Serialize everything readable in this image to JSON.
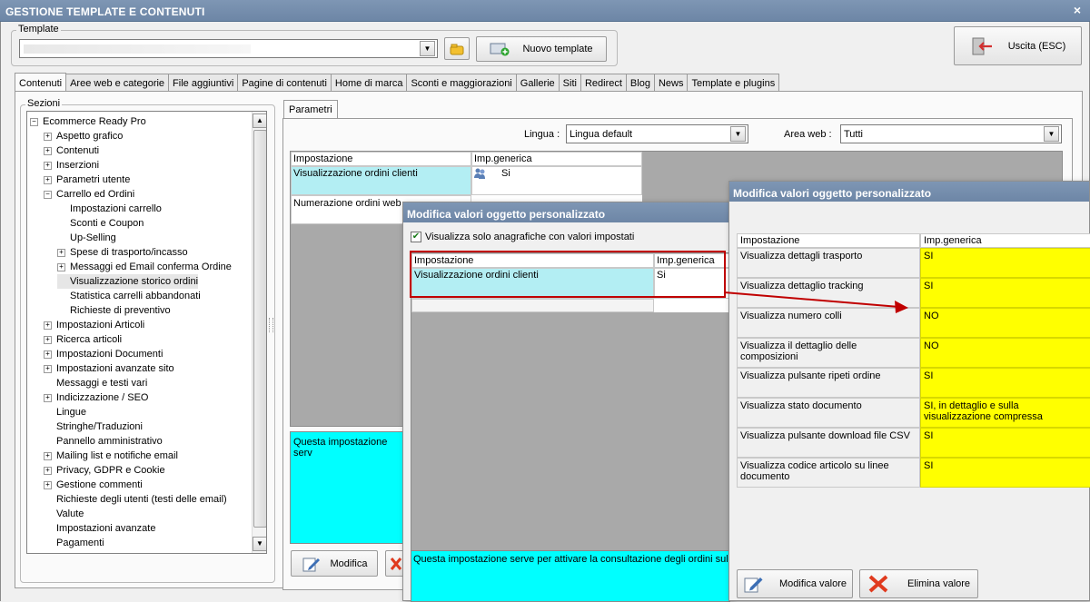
{
  "window": {
    "title": "GESTIONE TEMPLATE E CONTENUTI",
    "close": "×"
  },
  "template": {
    "group_label": "Template",
    "value": "",
    "new_button": "Nuovo template"
  },
  "exit_button": "Uscita (ESC)",
  "tabs": [
    "Contenuti",
    "Aree web e categorie",
    "File aggiuntivi",
    "Pagine di contenuti",
    "Home di marca",
    "Sconti e maggiorazioni",
    "Gallerie",
    "Siti",
    "Redirect",
    "Blog",
    "News",
    "Template e plugins"
  ],
  "sections": {
    "label": "Sezioni",
    "items": [
      {
        "text": "Ecommerce Ready Pro",
        "level": 0,
        "exp": "−"
      },
      {
        "text": "Aspetto grafico",
        "level": 1,
        "exp": "+"
      },
      {
        "text": "Contenuti",
        "level": 1,
        "exp": "+"
      },
      {
        "text": "Inserzioni",
        "level": 1,
        "exp": "+"
      },
      {
        "text": "Parametri utente",
        "level": 1,
        "exp": "+"
      },
      {
        "text": "Carrello ed Ordini",
        "level": 1,
        "exp": "−"
      },
      {
        "text": "Impostazioni carrello",
        "level": 2,
        "exp": ""
      },
      {
        "text": "Sconti e Coupon",
        "level": 2,
        "exp": ""
      },
      {
        "text": "Up-Selling",
        "level": 2,
        "exp": ""
      },
      {
        "text": "Spese di trasporto/incasso",
        "level": 2,
        "exp": "+"
      },
      {
        "text": "Messaggi ed Email conferma Ordine",
        "level": 2,
        "exp": "+"
      },
      {
        "text": "Visualizzazione storico ordini",
        "level": 2,
        "exp": "",
        "selected": true
      },
      {
        "text": "Statistica carrelli abbandonati",
        "level": 2,
        "exp": ""
      },
      {
        "text": "Richieste di preventivo",
        "level": 2,
        "exp": ""
      },
      {
        "text": "Impostazioni Articoli",
        "level": 1,
        "exp": "+"
      },
      {
        "text": "Ricerca articoli",
        "level": 1,
        "exp": "+"
      },
      {
        "text": "Impostazioni Documenti",
        "level": 1,
        "exp": "+"
      },
      {
        "text": "Impostazioni avanzate sito",
        "level": 1,
        "exp": "+"
      },
      {
        "text": "Messaggi e testi vari",
        "level": 1,
        "exp": ""
      },
      {
        "text": "Indicizzazione / SEO",
        "level": 1,
        "exp": "+"
      },
      {
        "text": "Lingue",
        "level": 1,
        "exp": ""
      },
      {
        "text": "Stringhe/Traduzioni",
        "level": 1,
        "exp": ""
      },
      {
        "text": "Pannello amministrativo",
        "level": 1,
        "exp": ""
      },
      {
        "text": "Mailing list e notifiche email",
        "level": 1,
        "exp": "+"
      },
      {
        "text": "Privacy, GDPR e Cookie",
        "level": 1,
        "exp": "+"
      },
      {
        "text": "Gestione commenti",
        "level": 1,
        "exp": "+"
      },
      {
        "text": "Richieste degli utenti (testi delle email)",
        "level": 1,
        "exp": ""
      },
      {
        "text": "Valute",
        "level": 1,
        "exp": ""
      },
      {
        "text": "Impostazioni avanzate",
        "level": 1,
        "exp": ""
      },
      {
        "text": "Pagamenti",
        "level": 1,
        "exp": ""
      }
    ]
  },
  "params": {
    "tab": "Parametri",
    "lingua_label": "Lingua :",
    "lingua_value": "Lingua default",
    "area_label": "Area web :",
    "area_value": "Tutti",
    "col1": "Impostazione",
    "col2": "Imp.generica",
    "rows": [
      {
        "name": "Visualizzazione ordini clienti",
        "value": "Si"
      },
      {
        "name": "Numerazione ordini web",
        "value": ""
      }
    ],
    "desc": "Questa impostazione serv",
    "modify_button": "Modifica"
  },
  "dialog1": {
    "title": "Modifica valori oggetto personalizzato",
    "checkbox_label": "Visualizza solo anagrafiche con valori impostati",
    "col1": "Impostazione",
    "col2": "Imp.generica",
    "row_name": "Visualizzazione ordini clienti",
    "row_value": "Si",
    "desc": "Questa impostazione serve per attivare la consultazione degli ordini sul p"
  },
  "dialog2": {
    "title": "Modifica valori oggetto personalizzato",
    "col1": "Impostazione",
    "col2": "Imp.generica",
    "rows": [
      {
        "name": "Visualizza dettagli trasporto",
        "value": "SI"
      },
      {
        "name": "Visualizza dettaglio tracking",
        "value": "SI"
      },
      {
        "name": "Visualizza numero colli",
        "value": "NO"
      },
      {
        "name": "Visualizza il dettaglio delle composizioni",
        "value": "NO"
      },
      {
        "name": "Visualizza pulsante ripeti ordine",
        "value": "SI"
      },
      {
        "name": "Visualizza stato documento",
        "value": "SI, in dettaglio e sulla visualizzazione compressa"
      },
      {
        "name": "Visualizza pulsante download file CSV",
        "value": "SI"
      },
      {
        "name": "Visualizza codice articolo su linee documento",
        "value": "SI"
      }
    ],
    "modify_button": "Modifica valore",
    "delete_button": "Elimina valore"
  },
  "colors": {
    "highlight_yellow": "#ffff00",
    "row_cyan": "#b3eef3",
    "desc_aqua": "#00ffff",
    "annotation_red": "#c00000"
  }
}
